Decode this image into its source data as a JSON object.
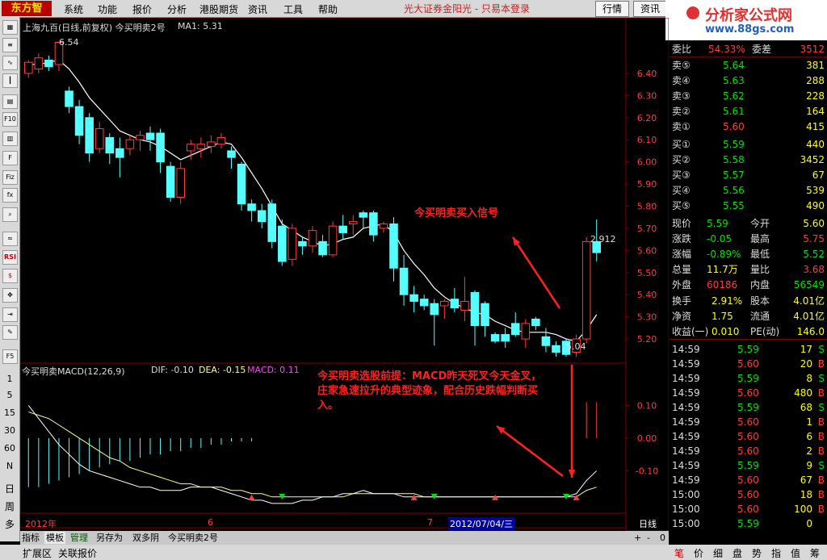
{
  "app": {
    "logo_text": "东方智",
    "broker": "光大证券金阳光 - 只易本登录"
  },
  "menu": [
    "系统",
    "功能",
    "报价",
    "分析",
    "港股期货",
    "资讯",
    "工具",
    "帮助"
  ],
  "top_buttons": {
    "quotes": "行情",
    "info": "资讯"
  },
  "brand": {
    "name": "分析家公式网",
    "url": "www.88gs.com"
  },
  "left_toolbar": {
    "periods": [
      "日",
      "周",
      "多"
    ],
    "numbers": [
      "1",
      "5",
      "15",
      "30",
      "60",
      "N"
    ]
  },
  "chart_header": {
    "stock": "上海九百(日线,前复权) 今买明卖2号",
    "ma_label": "MA1: 5.31",
    "high_label": "6.54",
    "low_label": "5.04",
    "last_label": "2.912"
  },
  "macd_header": {
    "name": "今买明卖MACD(12,26,9)",
    "dif": "DIF: -0.10",
    "dea": "DEA: -0.15",
    "macd": "MACD: 0.11"
  },
  "annotations": {
    "signal": "今买明卖买入信号",
    "premise": "今买明卖选股前提：MACD昨天死叉今天金叉，庄家急速拉升的典型迹象，配合历史跌幅判断买入。"
  },
  "price_axis": [
    "6.40",
    "6.30",
    "6.20",
    "6.10",
    "6.00",
    "5.90",
    "5.80",
    "5.70",
    "5.60",
    "5.50",
    "5.40",
    "5.30",
    "5.20"
  ],
  "macd_axis": [
    "0.10",
    "0.00",
    "-0.10"
  ],
  "date_axis": {
    "year": "2012年",
    "m6": "6",
    "m7": "7",
    "cursor": "2012/07/04/三",
    "period": "日线"
  },
  "chart_data": {
    "type": "candlestick",
    "title": "上海九百(日线,前复权)",
    "ylim": [
      5.12,
      6.52
    ],
    "price_ticks": [
      6.4,
      6.3,
      6.2,
      6.1,
      6.0,
      5.9,
      5.8,
      5.7,
      5.6,
      5.5,
      5.4,
      5.3,
      5.2
    ],
    "candles": [
      [
        6.4,
        6.45,
        6.38,
        6.46
      ],
      [
        6.42,
        6.47,
        6.4,
        6.49
      ],
      [
        6.46,
        6.43,
        6.41,
        6.48
      ],
      [
        6.44,
        6.54,
        6.41,
        6.54
      ],
      [
        6.32,
        6.25,
        6.22,
        6.34
      ],
      [
        6.25,
        6.12,
        6.08,
        6.28
      ],
      [
        6.2,
        6.04,
        6.0,
        6.22
      ],
      [
        6.06,
        6.15,
        6.04,
        6.18
      ],
      [
        6.11,
        6.04,
        5.99,
        6.13
      ],
      [
        6.06,
        6.02,
        5.93,
        6.11
      ],
      [
        6.06,
        6.1,
        6.03,
        6.12
      ],
      [
        6.1,
        6.12,
        6.05,
        6.14
      ],
      [
        6.13,
        6.1,
        6.05,
        6.16
      ],
      [
        6.13,
        6.0,
        5.95,
        6.15
      ],
      [
        5.98,
        5.84,
        5.82,
        6.0
      ],
      [
        5.84,
        5.97,
        5.81,
        6.0
      ],
      [
        6.05,
        6.08,
        6.01,
        6.1
      ],
      [
        6.06,
        6.08,
        6.02,
        6.11
      ],
      [
        6.07,
        6.09,
        6.04,
        6.12
      ],
      [
        6.08,
        6.11,
        6.06,
        6.13
      ],
      [
        6.05,
        6.02,
        5.97,
        6.07
      ],
      [
        5.99,
        5.81,
        5.78,
        6.0
      ],
      [
        5.81,
        5.78,
        5.73,
        5.83
      ],
      [
        5.78,
        5.73,
        5.7,
        5.81
      ],
      [
        5.81,
        5.64,
        5.61,
        5.83
      ],
      [
        5.71,
        5.55,
        5.53,
        5.74
      ],
      [
        5.56,
        5.7,
        5.53,
        5.72
      ],
      [
        5.64,
        5.62,
        5.58,
        5.66
      ],
      [
        5.62,
        5.69,
        5.59,
        5.71
      ],
      [
        5.64,
        5.58,
        5.57,
        5.67
      ],
      [
        5.58,
        5.71,
        5.57,
        5.73
      ],
      [
        5.71,
        5.68,
        5.65,
        5.76
      ],
      [
        5.72,
        5.73,
        5.67,
        5.76
      ],
      [
        5.77,
        5.75,
        5.7,
        5.78
      ],
      [
        5.77,
        5.67,
        5.64,
        5.78
      ],
      [
        5.7,
        5.72,
        5.68,
        5.73
      ],
      [
        5.72,
        5.52,
        5.46,
        5.75
      ],
      [
        5.52,
        5.4,
        5.35,
        5.58
      ],
      [
        5.4,
        5.37,
        5.32,
        5.44
      ],
      [
        5.38,
        5.35,
        5.33,
        5.4
      ],
      [
        5.36,
        5.31,
        5.17,
        5.38
      ],
      [
        5.35,
        5.37,
        5.29,
        5.38
      ],
      [
        5.38,
        5.34,
        5.32,
        5.43
      ],
      [
        5.33,
        5.37,
        5.28,
        5.48
      ],
      [
        5.41,
        5.26,
        5.17,
        5.42
      ],
      [
        5.36,
        5.26,
        5.21,
        5.37
      ],
      [
        5.22,
        5.19,
        5.18,
        5.23
      ],
      [
        5.22,
        5.19,
        5.16,
        5.25
      ],
      [
        5.27,
        5.22,
        5.21,
        5.32
      ],
      [
        5.2,
        5.27,
        5.16,
        5.29
      ],
      [
        5.29,
        5.26,
        5.24,
        5.3
      ],
      [
        5.21,
        5.17,
        5.14,
        5.25
      ],
      [
        5.17,
        5.14,
        5.12,
        5.19
      ],
      [
        5.19,
        5.13,
        5.12,
        5.2
      ],
      [
        5.14,
        5.2,
        5.12,
        5.22
      ],
      [
        5.2,
        5.64,
        5.18,
        5.66
      ],
      [
        5.64,
        5.59,
        5.55,
        5.74
      ]
    ],
    "ma": [
      6.44,
      6.44,
      6.45,
      6.46,
      6.42,
      6.36,
      6.29,
      6.24,
      6.19,
      6.14,
      6.12,
      6.1,
      6.09,
      6.07,
      6.04,
      6.01,
      6.03,
      6.05,
      6.07,
      6.09,
      6.08,
      6.02,
      5.95,
      5.88,
      5.8,
      5.72,
      5.69,
      5.66,
      5.64,
      5.62,
      5.63,
      5.65,
      5.66,
      5.7,
      5.71,
      5.72,
      5.68,
      5.6,
      5.54,
      5.49,
      5.43,
      5.39,
      5.36,
      5.34,
      5.32,
      5.31,
      5.28,
      5.26,
      5.24,
      5.23,
      5.23,
      5.23,
      5.22,
      5.2,
      5.19,
      5.24,
      5.31
    ],
    "macd_ylim": [
      -0.22,
      0.2
    ],
    "macd_ticks": [
      0.1,
      0.0,
      -0.1
    ],
    "macd_hist": [
      -0.15,
      -0.15,
      -0.14,
      -0.13,
      -0.12,
      -0.11,
      -0.1,
      -0.09,
      -0.08,
      -0.07,
      -0.07,
      -0.06,
      -0.05,
      -0.05,
      -0.04,
      -0.04,
      -0.03,
      -0.03,
      -0.02,
      -0.02,
      -0.01,
      -0.01,
      -0.01,
      0,
      0,
      0,
      0,
      0,
      0,
      0,
      0,
      0,
      0,
      0,
      0,
      0,
      0,
      0,
      0,
      0,
      0,
      0,
      0,
      0,
      0,
      0,
      0,
      0,
      0,
      0,
      0,
      0,
      0,
      0,
      0,
      0.11,
      0.11
    ],
    "dif": [
      0.1,
      0.06,
      0.02,
      -0.02,
      -0.05,
      -0.08,
      -0.1,
      -0.11,
      -0.12,
      -0.13,
      -0.14,
      -0.15,
      -0.15,
      -0.16,
      -0.16,
      -0.16,
      -0.15,
      -0.15,
      -0.15,
      -0.16,
      -0.17,
      -0.18,
      -0.19,
      -0.19,
      -0.2,
      -0.2,
      -0.2,
      -0.19,
      -0.19,
      -0.18,
      -0.18,
      -0.17,
      -0.17,
      -0.16,
      -0.17,
      -0.17,
      -0.17,
      -0.18,
      -0.18,
      -0.18,
      -0.18,
      -0.18,
      -0.18,
      -0.18,
      -0.18,
      -0.18,
      -0.18,
      -0.18,
      -0.18,
      -0.18,
      -0.18,
      -0.18,
      -0.18,
      -0.18,
      -0.17,
      -0.13,
      -0.1
    ],
    "dea": [
      0.08,
      0.07,
      0.06,
      0.04,
      0.02,
      0.0,
      -0.02,
      -0.04,
      -0.06,
      -0.07,
      -0.09,
      -0.1,
      -0.11,
      -0.12,
      -0.13,
      -0.14,
      -0.14,
      -0.15,
      -0.15,
      -0.15,
      -0.16,
      -0.16,
      -0.17,
      -0.17,
      -0.18,
      -0.18,
      -0.18,
      -0.18,
      -0.18,
      -0.18,
      -0.18,
      -0.18,
      -0.17,
      -0.17,
      -0.17,
      -0.17,
      -0.17,
      -0.17,
      -0.17,
      -0.18,
      -0.18,
      -0.18,
      -0.18,
      -0.18,
      -0.18,
      -0.18,
      -0.18,
      -0.18,
      -0.18,
      -0.18,
      -0.18,
      -0.18,
      -0.18,
      -0.18,
      -0.18,
      -0.16,
      -0.15
    ]
  },
  "quote_panel": {
    "header": {
      "label1": "委比",
      "value1": "54.33%",
      "label2": "委差",
      "value2": "3512"
    },
    "asks": [
      {
        "label": "卖⑤",
        "price": "5.64",
        "vol": "381"
      },
      {
        "label": "卖④",
        "price": "5.63",
        "vol": "288"
      },
      {
        "label": "卖③",
        "price": "5.62",
        "vol": "228"
      },
      {
        "label": "卖②",
        "price": "5.61",
        "vol": "164"
      },
      {
        "label": "卖①",
        "price": "5.60",
        "vol": "415"
      }
    ],
    "bids": [
      {
        "label": "买①",
        "price": "5.59",
        "vol": "440"
      },
      {
        "label": "买②",
        "price": "5.58",
        "vol": "3452"
      },
      {
        "label": "买③",
        "price": "5.57",
        "vol": "67"
      },
      {
        "label": "买④",
        "price": "5.56",
        "vol": "539"
      },
      {
        "label": "买⑤",
        "price": "5.55",
        "vol": "490"
      }
    ],
    "stats": [
      {
        "l1": "现价",
        "v1": "5.59",
        "l2": "今开",
        "v2": "5.60"
      },
      {
        "l1": "涨跌",
        "v1": "-0.05",
        "l2": "最高",
        "v2": "5.75"
      },
      {
        "l1": "涨幅",
        "v1": "-0.89%",
        "l2": "最低",
        "v2": "5.52"
      },
      {
        "l1": "总量",
        "v1": "11.7万",
        "l2": "量比",
        "v2": "3.68"
      },
      {
        "l1": "外盘",
        "v1": "60186",
        "l2": "内盘",
        "v2": "56549"
      }
    ],
    "stats2": [
      {
        "l1": "换手",
        "v1": "2.91%",
        "l2": "股本",
        "v2": "4.01亿"
      },
      {
        "l1": "净资",
        "v1": "1.75",
        "l2": "流通",
        "v2": "4.01亿"
      },
      {
        "l1": "收益(一)",
        "v1": "0.010",
        "l2": "PE(动)",
        "v2": "146.0"
      }
    ],
    "ticks": [
      {
        "time": "14:59",
        "price": "5.59",
        "vol": "17",
        "side": "S"
      },
      {
        "time": "14:59",
        "price": "5.60",
        "vol": "20",
        "side": "B"
      },
      {
        "time": "14:59",
        "price": "5.59",
        "vol": "8",
        "side": "S"
      },
      {
        "time": "14:59",
        "price": "5.60",
        "vol": "480",
        "side": "B"
      },
      {
        "time": "14:59",
        "price": "5.59",
        "vol": "68",
        "side": "S"
      },
      {
        "time": "14:59",
        "price": "5.60",
        "vol": "1",
        "side": "B"
      },
      {
        "time": "14:59",
        "price": "5.60",
        "vol": "6",
        "side": "B"
      },
      {
        "time": "14:59",
        "price": "5.60",
        "vol": "2",
        "side": "B"
      },
      {
        "time": "14:59",
        "price": "5.59",
        "vol": "9",
        "side": "S"
      },
      {
        "time": "14:59",
        "price": "5.60",
        "vol": "67",
        "side": "B"
      },
      {
        "time": "15:00",
        "price": "5.60",
        "vol": "18",
        "side": "B"
      },
      {
        "time": "15:00",
        "price": "5.60",
        "vol": "100",
        "side": "B"
      },
      {
        "time": "15:00",
        "price": "5.59",
        "vol": "0",
        "side": ""
      }
    ]
  },
  "bottom_tabs": [
    "指标",
    "模板",
    "管理",
    "另存为",
    "双多阴",
    "今买明卖2号"
  ],
  "footer_tabs": [
    "扩展区",
    "关联报价"
  ],
  "right_footer_tabs": [
    "笔",
    "价",
    "细",
    "盘",
    "势",
    "指",
    "值",
    "筹"
  ],
  "colors": {
    "up": "#ff3c3c",
    "down": "#54ffff",
    "ma": "#ffffff",
    "dea": "#ffff80",
    "grid": "#800000",
    "annotation": "#ff2020"
  }
}
